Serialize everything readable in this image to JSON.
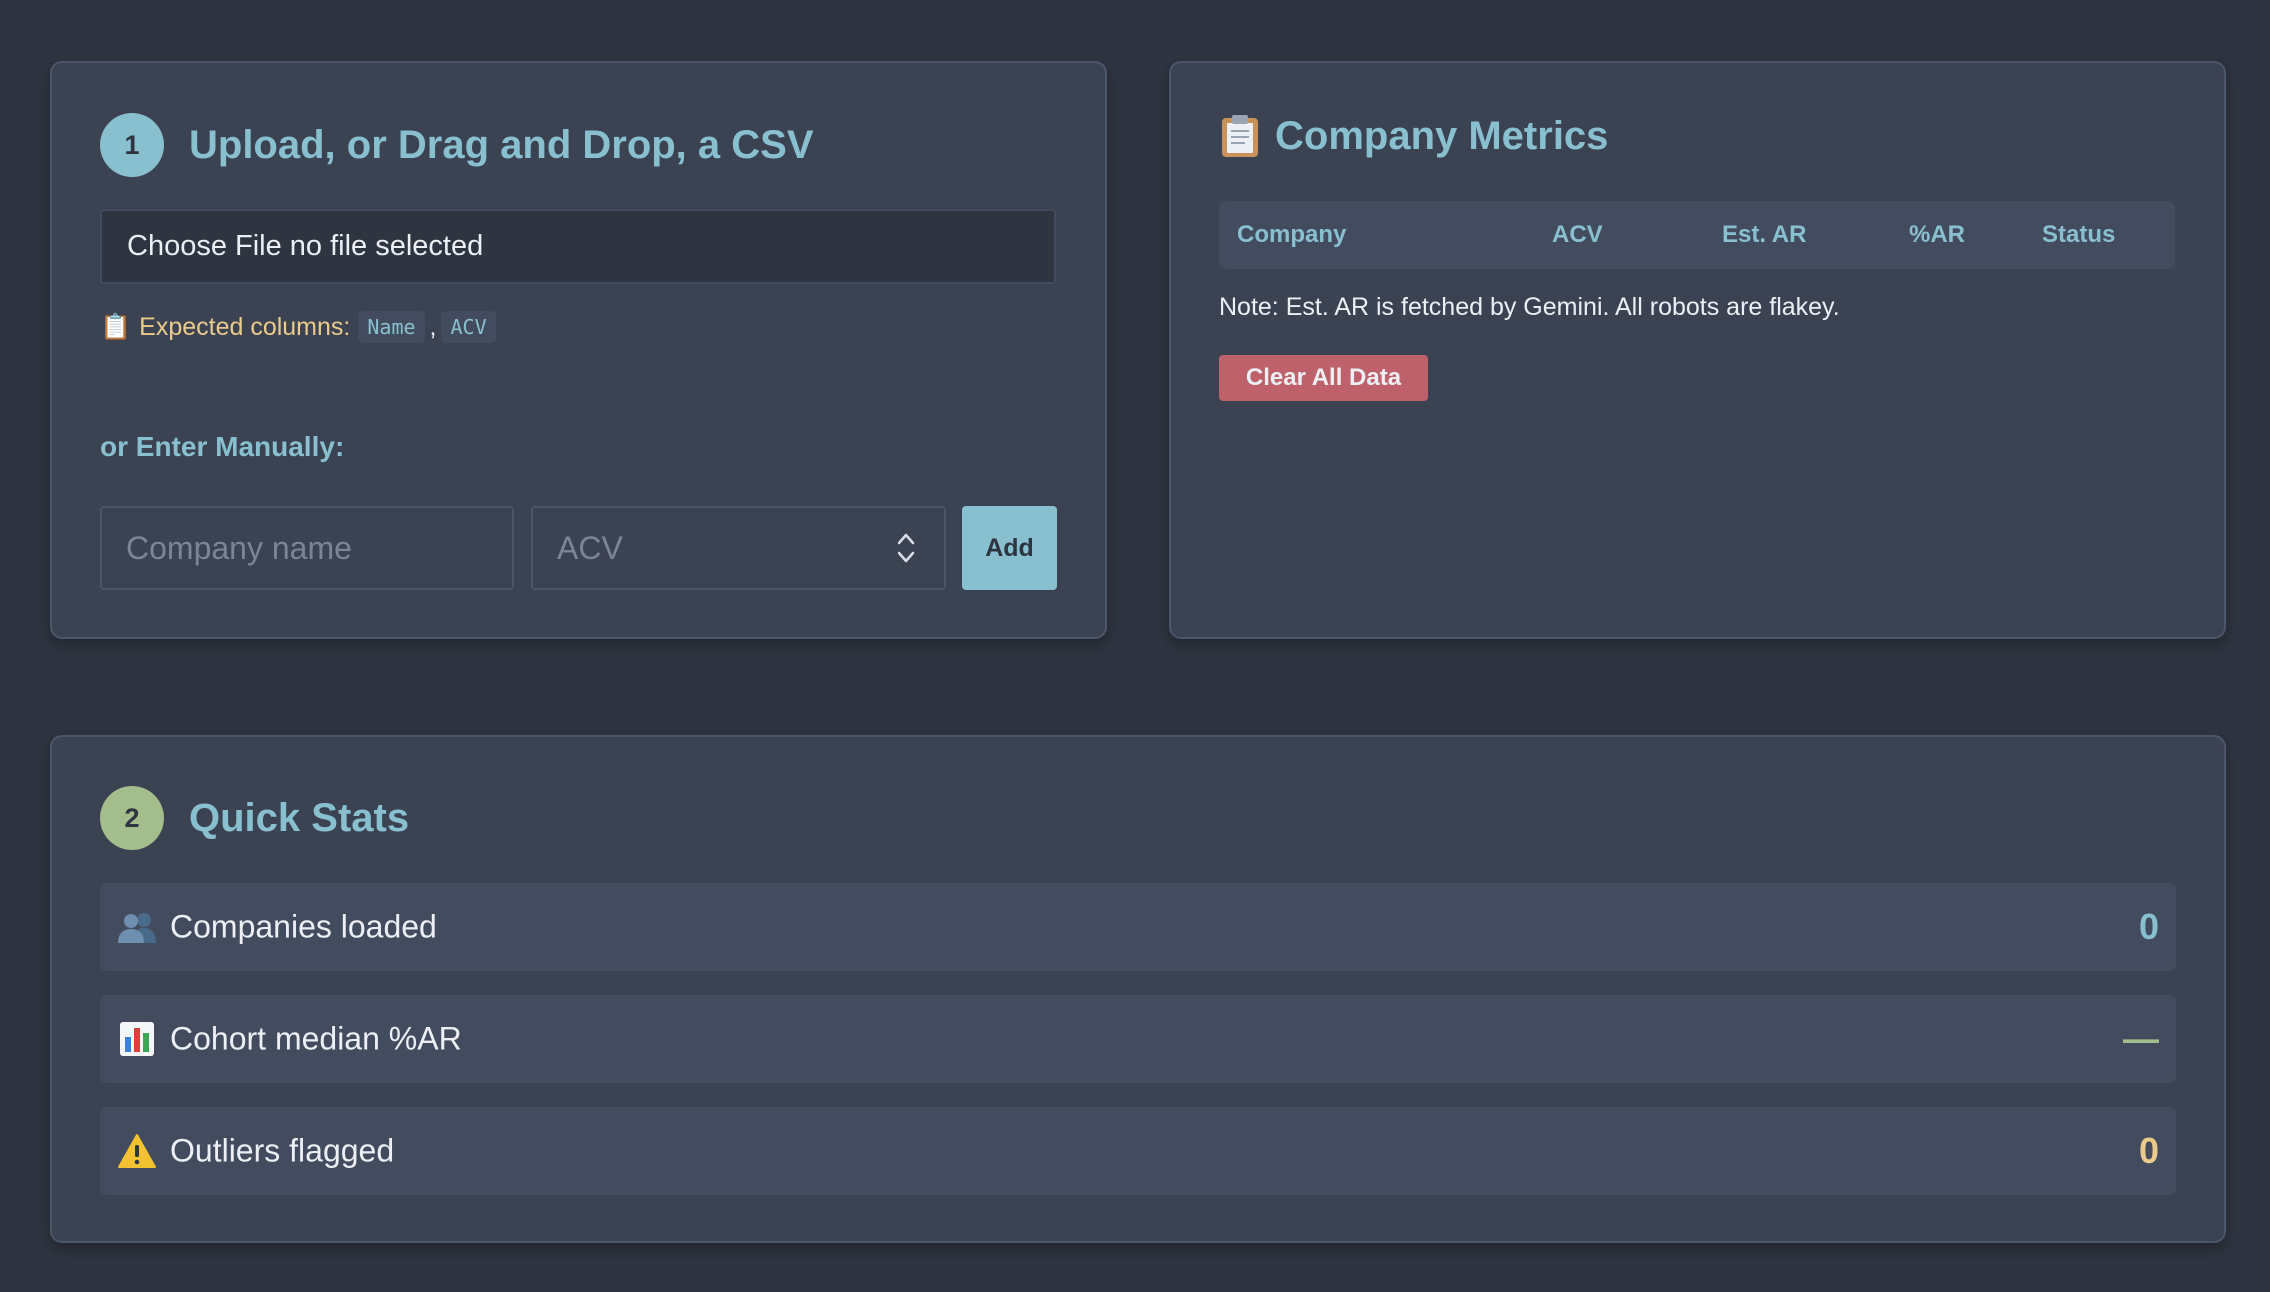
{
  "upload": {
    "step_number": "1",
    "title": "Upload, or Drag and Drop, a CSV",
    "file_button_label": "Choose File",
    "file_status": "no file selected",
    "expected_label": "Expected columns:",
    "expected_columns": [
      "Name",
      "ACV"
    ],
    "column_separator": ",",
    "manual_label": "or Enter Manually:",
    "company_placeholder": "Company name",
    "acv_placeholder": "ACV",
    "add_label": "Add"
  },
  "metrics": {
    "title": "Company Metrics",
    "columns": [
      "Company",
      "ACV",
      "Est. AR",
      "%AR",
      "Status"
    ],
    "rows": [],
    "note": "Note: Est. AR is fetched by Gemini. All robots are flakey.",
    "clear_label": "Clear All Data"
  },
  "stats": {
    "step_number": "2",
    "title": "Quick Stats",
    "companies_loaded": {
      "label": "Companies loaded",
      "value": "0",
      "icon": "people-icon"
    },
    "cohort_median": {
      "label": "Cohort median %AR",
      "value": "—",
      "icon": "bar-chart-icon"
    },
    "outliers": {
      "label": "Outliers flagged",
      "value": "0",
      "icon": "warning-icon"
    }
  },
  "colors": {
    "background": "#2e3440",
    "card": "#3b4252",
    "accent": "#88c0d0",
    "green": "#a3be8c",
    "yellow": "#ebcb8b",
    "red": "#bf616a"
  }
}
